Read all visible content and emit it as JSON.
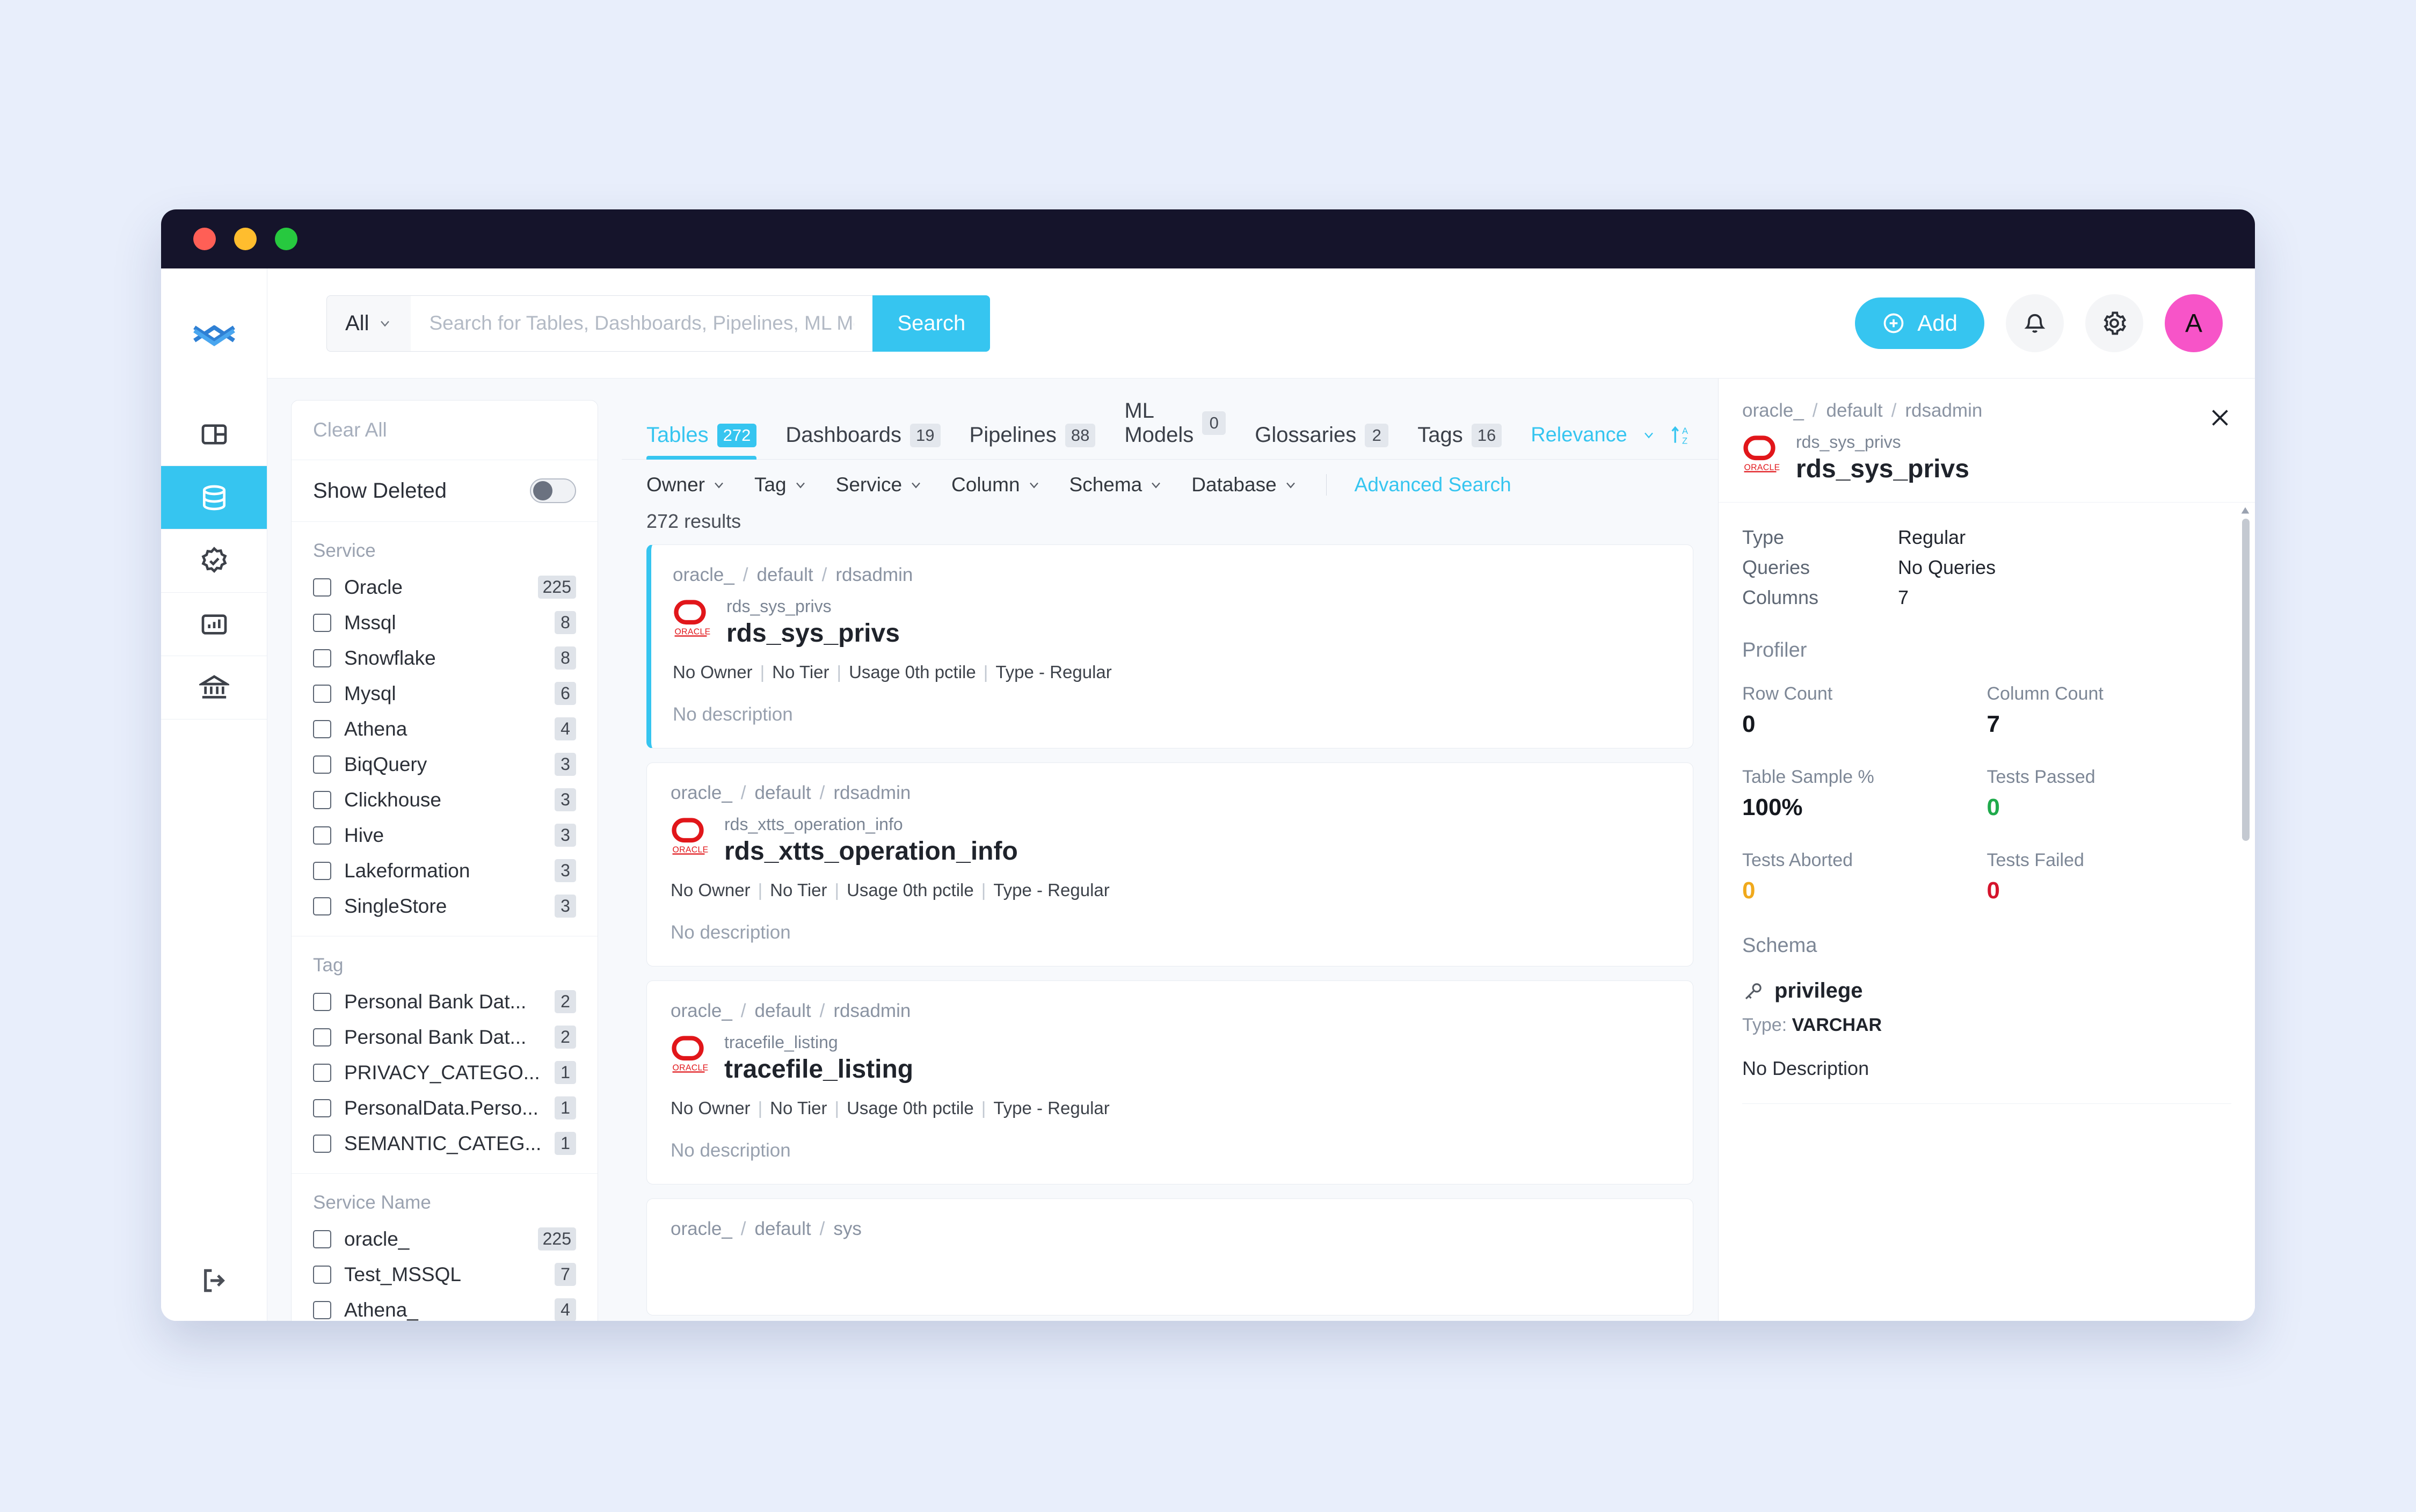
{
  "window": {
    "traffic_lights": [
      "close",
      "minimize",
      "maximize"
    ]
  },
  "header": {
    "search_kind": "All",
    "search_value": "",
    "search_placeholder": "Search for Tables, Dashboards, Pipelines, ML Mod...",
    "search_button": "Search",
    "add_button": "Add",
    "notifications_icon": "bell-icon",
    "settings_icon": "gear-icon",
    "avatar_initial": "A"
  },
  "rail": {
    "logo": "openmetadata-logo",
    "items": [
      {
        "name": "my-data",
        "icon": "layout-panels-icon",
        "active": false
      },
      {
        "name": "explore",
        "icon": "database-icon",
        "active": true
      },
      {
        "name": "quality",
        "icon": "badge-check-icon",
        "active": false
      },
      {
        "name": "insights",
        "icon": "chart-report-icon",
        "active": false
      },
      {
        "name": "governance",
        "icon": "bank-icon",
        "active": false
      }
    ],
    "logout_icon": "logout-icon"
  },
  "filters": {
    "clear_all": "Clear All",
    "show_deleted_label": "Show Deleted",
    "show_deleted_on": false,
    "groups": [
      {
        "title": "Service",
        "options": [
          {
            "label": "Oracle",
            "count": "225"
          },
          {
            "label": "Mssql",
            "count": "8"
          },
          {
            "label": "Snowflake",
            "count": "8"
          },
          {
            "label": "Mysql",
            "count": "6"
          },
          {
            "label": "Athena",
            "count": "4"
          },
          {
            "label": "BiqQuery",
            "count": "3"
          },
          {
            "label": "Clickhouse",
            "count": "3"
          },
          {
            "label": "Hive",
            "count": "3"
          },
          {
            "label": "Lakeformation",
            "count": "3"
          },
          {
            "label": "SingleStore",
            "count": "3"
          }
        ]
      },
      {
        "title": "Tag",
        "options": [
          {
            "label": "Personal Bank Dat...",
            "count": "2"
          },
          {
            "label": "Personal Bank Dat...",
            "count": "2"
          },
          {
            "label": "PRIVACY_CATEGO...",
            "count": "1"
          },
          {
            "label": "PersonalData.Perso...",
            "count": "1"
          },
          {
            "label": "SEMANTIC_CATEG...",
            "count": "1"
          }
        ]
      },
      {
        "title": "Service Name",
        "options": [
          {
            "label": "oracle_",
            "count": "225"
          },
          {
            "label": "Test_MSSQL",
            "count": "7"
          },
          {
            "label": "Athena_",
            "count": "4"
          }
        ]
      }
    ]
  },
  "results_panel": {
    "tabs": [
      {
        "label": "Tables",
        "count": "272",
        "active": true
      },
      {
        "label": "Dashboards",
        "count": "19",
        "active": false
      },
      {
        "label": "Pipelines",
        "count": "88",
        "active": false
      },
      {
        "label": "ML Models",
        "count": "0",
        "active": false
      },
      {
        "label": "Glossaries",
        "count": "2",
        "active": false
      },
      {
        "label": "Tags",
        "count": "16",
        "active": false
      }
    ],
    "sort_label": "Relevance",
    "sort_order_icon": "sort-az-icon",
    "dropdowns": [
      "Owner",
      "Tag",
      "Service",
      "Column",
      "Schema",
      "Database"
    ],
    "advanced_search": "Advanced Search",
    "results_count_text": "272 results",
    "cards": [
      {
        "breadcrumb": [
          "oracle_",
          "default",
          "rdsadmin"
        ],
        "sub_title": "rds_sys_privs",
        "title": "rds_sys_privs",
        "service_icon": "oracle-logo-icon",
        "owner": "No Owner",
        "tier": "No Tier",
        "usage": "Usage 0th pctile",
        "type": "Type -  Regular",
        "description": "No description",
        "selected": true
      },
      {
        "breadcrumb": [
          "oracle_",
          "default",
          "rdsadmin"
        ],
        "sub_title": "rds_xtts_operation_info",
        "title": "rds_xtts_operation_info",
        "service_icon": "oracle-logo-icon",
        "owner": "No Owner",
        "tier": "No Tier",
        "usage": "Usage 0th pctile",
        "type": "Type -  Regular",
        "description": "No description",
        "selected": false
      },
      {
        "breadcrumb": [
          "oracle_",
          "default",
          "rdsadmin"
        ],
        "sub_title": "tracefile_listing",
        "title": "tracefile_listing",
        "service_icon": "oracle-logo-icon",
        "owner": "No Owner",
        "tier": "No Tier",
        "usage": "Usage 0th pctile",
        "type": "Type -  Regular",
        "description": "No description",
        "selected": false
      },
      {
        "breadcrumb": [
          "oracle_",
          "default",
          "sys"
        ],
        "sub_title": "",
        "title": "",
        "service_icon": "oracle-logo-icon",
        "owner": "",
        "tier": "",
        "usage": "",
        "type": "",
        "description": "",
        "selected": false
      }
    ]
  },
  "detail_panel": {
    "breadcrumb": [
      "oracle_",
      "default",
      "rdsadmin"
    ],
    "sub_title": "rds_sys_privs",
    "title": "rds_sys_privs",
    "service_icon": "oracle-logo-icon",
    "close_icon": "close-icon",
    "properties": [
      {
        "key": "Type",
        "value": "Regular"
      },
      {
        "key": "Queries",
        "value": "No Queries"
      },
      {
        "key": "Columns",
        "value": "7"
      }
    ],
    "profiler_title": "Profiler",
    "stats": [
      {
        "label": "Row Count",
        "value": "0",
        "color": ""
      },
      {
        "label": "Column Count",
        "value": "7",
        "color": ""
      },
      {
        "label": "Table Sample %",
        "value": "100%",
        "color": ""
      },
      {
        "label": "Tests Passed",
        "value": "0",
        "color": "green"
      },
      {
        "label": "Tests Aborted",
        "value": "0",
        "color": "amber"
      },
      {
        "label": "Tests Failed",
        "value": "0",
        "color": "red"
      }
    ],
    "schema_title": "Schema",
    "columns": [
      {
        "name": "privilege",
        "key_icon": "key-icon",
        "type_label": "Type:",
        "type_value": "VARCHAR",
        "description": "No Description"
      }
    ]
  },
  "colors": {
    "accent": "#36c5f0",
    "avatar": "#f754c8",
    "titlebar": "#15142b",
    "page_bg": "#e8eefb",
    "green": "#1faa4b",
    "amber": "#f0a91c",
    "red": "#d5142c"
  }
}
